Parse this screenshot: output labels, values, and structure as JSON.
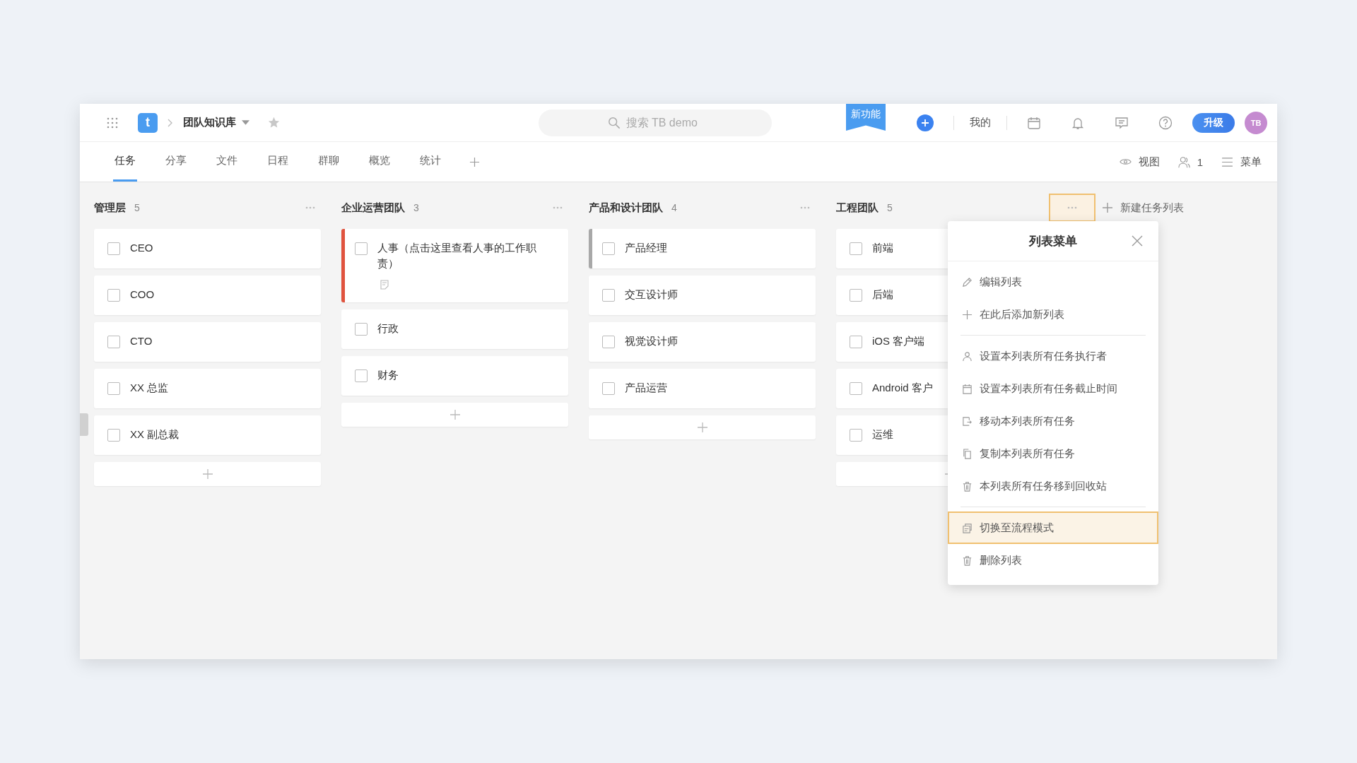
{
  "header": {
    "logo": "t",
    "project": "团队知识库",
    "search": {
      "placeholder": "搜索 TB demo"
    },
    "new_feature_badge": "新功能",
    "mine": "我的",
    "upgrade": "升级",
    "avatar": "TB"
  },
  "tabs": [
    {
      "label": "任务",
      "selected": true
    },
    {
      "label": "分享",
      "selected": false
    },
    {
      "label": "文件",
      "selected": false
    },
    {
      "label": "日程",
      "selected": false
    },
    {
      "label": "群聊",
      "selected": false
    },
    {
      "label": "概览",
      "selected": false
    },
    {
      "label": "统计",
      "selected": false
    }
  ],
  "toolbar": {
    "view": "视图",
    "members": "1",
    "menu": "菜单"
  },
  "columns": [
    {
      "name": "管理层",
      "count": "5",
      "menu_open": false,
      "cards": [
        {
          "title": "CEO",
          "checked": false
        },
        {
          "title": "COO",
          "checked": false
        },
        {
          "title": "CTO",
          "checked": false
        },
        {
          "title": "XX 总监",
          "checked": false
        },
        {
          "title": "XX 副总裁",
          "checked": false
        }
      ]
    },
    {
      "name": "企业运营团队",
      "count": "3",
      "menu_open": false,
      "cards": [
        {
          "title": "人事（点击这里查看人事的工作职责）",
          "checked": false,
          "color": "#e0533e",
          "has_note": true
        },
        {
          "title": "行政",
          "checked": false
        },
        {
          "title": "财务",
          "checked": false
        }
      ]
    },
    {
      "name": "产品和设计团队",
      "count": "4",
      "menu_open": false,
      "cards": [
        {
          "title": "产品经理",
          "checked": false,
          "color": "#a8a8a8"
        },
        {
          "title": "交互设计师",
          "checked": false
        },
        {
          "title": "视觉设计师",
          "checked": false
        },
        {
          "title": "产品运营",
          "checked": false
        }
      ]
    },
    {
      "name": "工程团队",
      "count": "5",
      "menu_open": true,
      "cards": [
        {
          "title": "前端",
          "checked": false
        },
        {
          "title": "后端",
          "checked": false
        },
        {
          "title": "iOS 客户端",
          "checked": false
        },
        {
          "title": "Android 客户",
          "checked": false
        },
        {
          "title": "运维",
          "checked": false
        }
      ]
    }
  ],
  "new_list": "新建任务列表",
  "list_menu": {
    "title": "列表菜单",
    "sections": [
      [
        {
          "kind": "edit",
          "label": "编辑列表",
          "highlighted": false
        },
        {
          "kind": "add",
          "label": "在此后添加新列表",
          "highlighted": false
        }
      ],
      [
        {
          "kind": "assignee",
          "label": "设置本列表所有任务执行者",
          "highlighted": false
        },
        {
          "kind": "due",
          "label": "设置本列表所有任务截止时间",
          "highlighted": false
        },
        {
          "kind": "move",
          "label": "移动本列表所有任务",
          "highlighted": false
        },
        {
          "kind": "copy",
          "label": "复制本列表所有任务",
          "highlighted": false
        },
        {
          "kind": "trash",
          "label": "本列表所有任务移到回收站",
          "highlighted": false
        }
      ],
      [
        {
          "kind": "switch",
          "label": "切换至流程模式",
          "highlighted": true
        },
        {
          "kind": "trash",
          "label": "删除列表",
          "highlighted": false
        }
      ]
    ]
  }
}
